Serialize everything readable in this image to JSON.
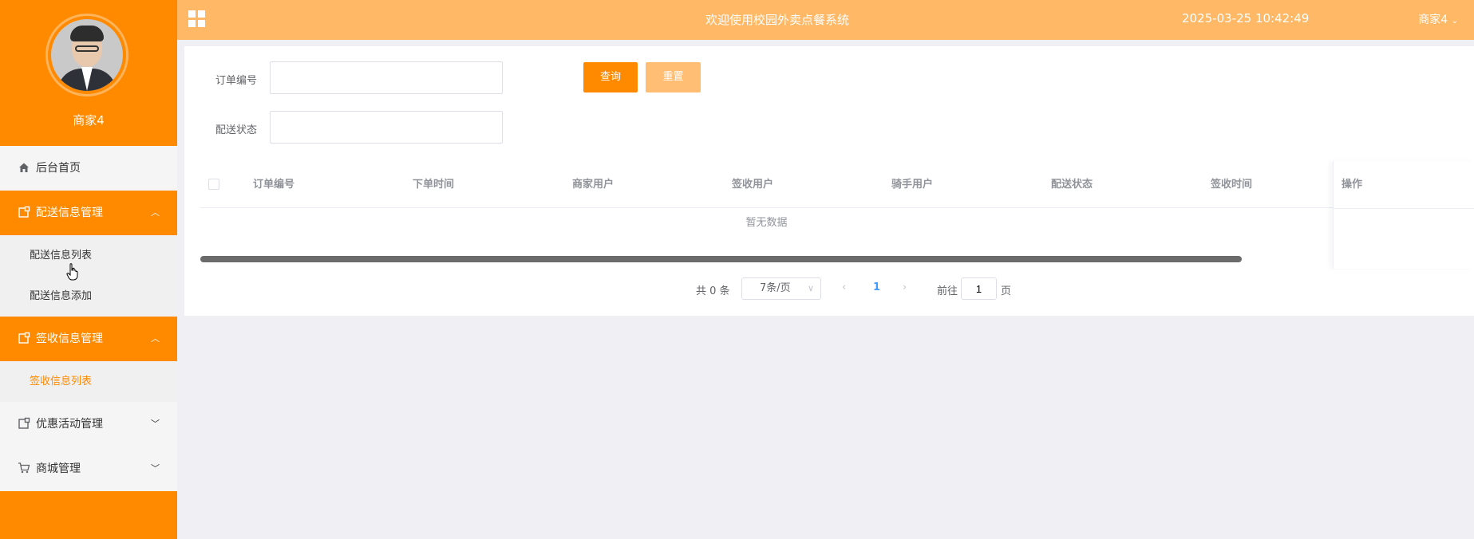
{
  "sidebar": {
    "username": "商家4",
    "menu": [
      {
        "label": "后台首页",
        "icon": "home-icon"
      },
      {
        "label": "配送信息管理",
        "icon": "folder-icon",
        "expanded": true,
        "children": [
          {
            "label": "配送信息列表"
          },
          {
            "label": "配送信息添加"
          }
        ]
      },
      {
        "label": "签收信息管理",
        "icon": "folder-icon",
        "expanded": true,
        "children": [
          {
            "label": "签收信息列表"
          }
        ]
      },
      {
        "label": "优惠活动管理",
        "icon": "folder-icon",
        "expanded": false
      },
      {
        "label": "商城管理",
        "icon": "cart-icon",
        "expanded": false
      }
    ]
  },
  "header": {
    "title": "欢迎使用校园外卖点餐系统",
    "datetime": "2025-03-25 10:42:49",
    "user": "商家4"
  },
  "search": {
    "order_no_label": "订单编号",
    "order_no_value": "",
    "status_label": "配送状态",
    "status_value": "",
    "query_button": "查询",
    "reset_button": "重置"
  },
  "table": {
    "columns": [
      "订单编号",
      "下单时间",
      "商家用户",
      "签收用户",
      "骑手用户",
      "配送状态",
      "签收时间"
    ],
    "action_column": "操作",
    "rows": [],
    "empty_text": "暂无数据"
  },
  "pagination": {
    "total_text": "共 0 条",
    "page_size": "7条/页",
    "current_page": "1",
    "goto_label": "前往",
    "goto_value": "1",
    "page_unit": "页"
  },
  "colors": {
    "sidebar": "#ff8a00",
    "topbar": "#ffb866",
    "accent": "#ff8a00",
    "reset": "#ffbe73",
    "page_active": "#409eff"
  }
}
